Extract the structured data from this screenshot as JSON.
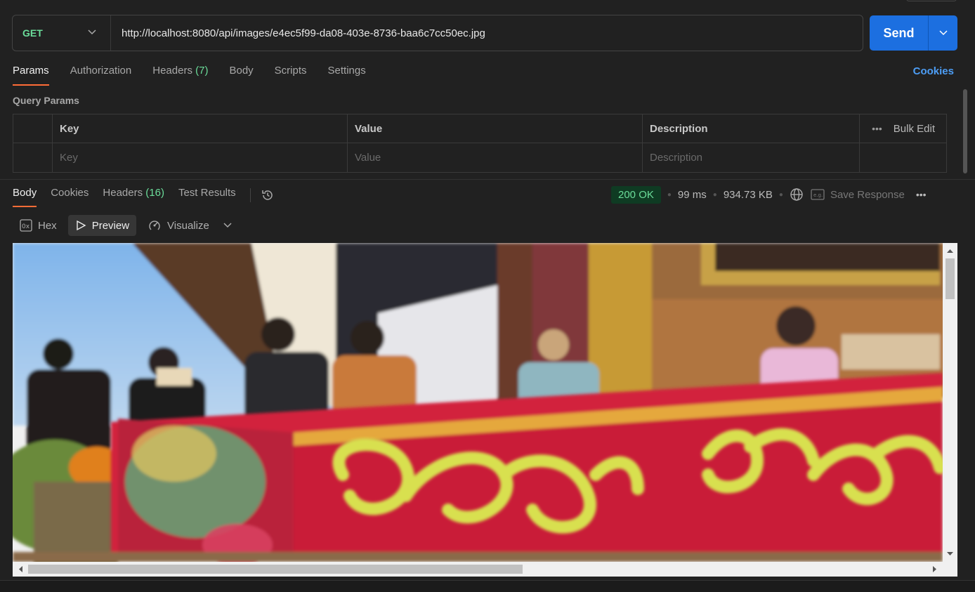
{
  "request": {
    "method": "GET",
    "url": "http://localhost:8080/api/images/e4ec5f99-da08-403e-8736-baa6c7cc50ec.jpg",
    "send_label": "Send"
  },
  "req_tabs": {
    "params": "Params",
    "authorization": "Authorization",
    "headers": "Headers",
    "headers_count": "(7)",
    "body": "Body",
    "scripts": "Scripts",
    "settings": "Settings",
    "cookies": "Cookies"
  },
  "query_params": {
    "title": "Query Params",
    "headers": {
      "key": "Key",
      "value": "Value",
      "description": "Description",
      "bulk_edit": "Bulk Edit"
    },
    "placeholders": {
      "key": "Key",
      "value": "Value",
      "description": "Description"
    }
  },
  "resp_tabs": {
    "body": "Body",
    "cookies": "Cookies",
    "headers": "Headers",
    "headers_count": "(16)",
    "test_results": "Test Results"
  },
  "response": {
    "status": "200 OK",
    "time": "99 ms",
    "size": "934.73 KB",
    "save_label": "Save Response"
  },
  "view": {
    "hex": "Hex",
    "preview": "Preview",
    "visualize": "Visualize"
  },
  "colors": {
    "accent_tab": "#ff6c37",
    "send": "#1c6fe0",
    "method": "#6bdd9a",
    "status_ok": "#6bdd9a"
  }
}
